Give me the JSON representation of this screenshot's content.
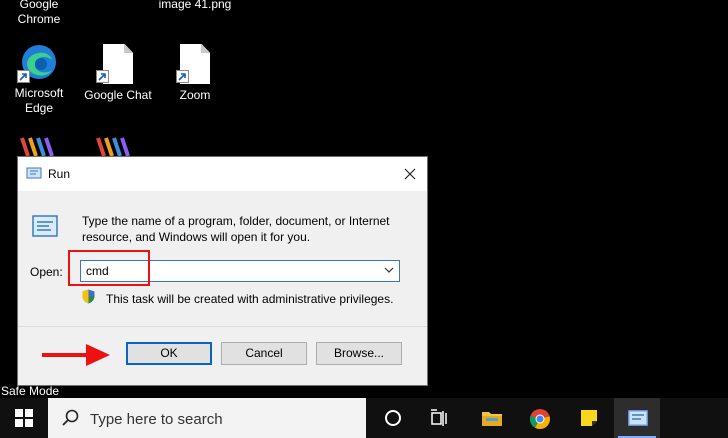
{
  "desktop": {
    "top_labels": [
      {
        "line1": "Google",
        "line2": "Chrome"
      },
      {
        "line1": "image 41.png",
        "line2": ""
      }
    ],
    "icons": [
      {
        "line1": "Microsoft",
        "line2": "Edge",
        "icon": "edge-icon"
      },
      {
        "line1": "Google Chat",
        "line2": "",
        "icon": "file-shortcut-icon"
      },
      {
        "line1": "Zoom",
        "line2": "",
        "icon": "file-shortcut-icon"
      }
    ],
    "safe_mode": "Safe Mode"
  },
  "run_dialog": {
    "title": "Run",
    "description": "Type the name of a program, folder, document, or Internet resource, and Windows will open it for you.",
    "open_label": "Open:",
    "open_value": "cmd",
    "admin_note": "This task will be created with administrative privileges.",
    "buttons": {
      "ok": "OK",
      "cancel": "Cancel",
      "browse": "Browse..."
    },
    "colors": {
      "highlight": "#e11111",
      "accent": "#0a64c8"
    }
  },
  "taskbar": {
    "search_placeholder": "Type here to search",
    "items": [
      "cortana-icon",
      "task-view-icon",
      "file-explorer-icon",
      "chrome-icon",
      "sticky-notes-icon",
      "run-icon"
    ]
  }
}
